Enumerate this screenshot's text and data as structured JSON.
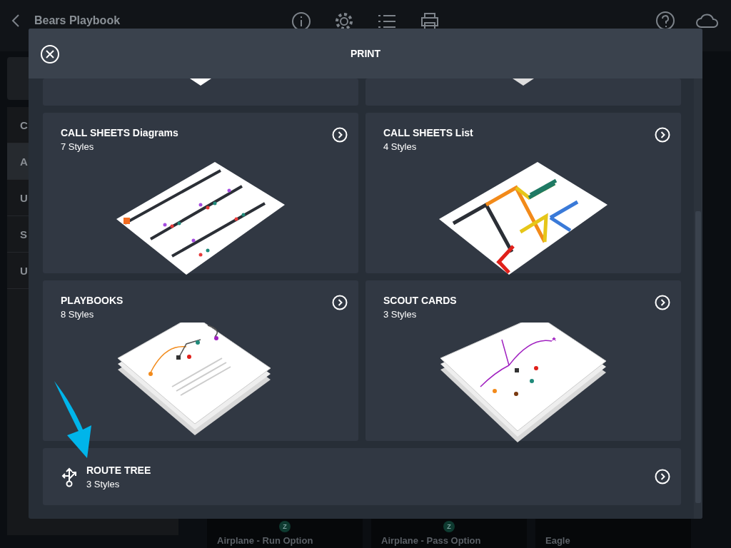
{
  "app": {
    "title": "Bears Playbook"
  },
  "sidebar": {
    "items": [
      {
        "label": "C",
        "selected": false
      },
      {
        "label": "A",
        "selected": true
      },
      {
        "label": "U",
        "selected": false
      },
      {
        "label": "S",
        "selected": false
      },
      {
        "label": "U",
        "selected": false
      }
    ]
  },
  "plays": [
    {
      "title": "Airplane - Run Option",
      "marker": "Z"
    },
    {
      "title": "Airplane - Pass Option",
      "marker": "Z"
    },
    {
      "title": "Eagle"
    }
  ],
  "dialog": {
    "title": "PRINT",
    "options": [
      {
        "kind": "diagrams",
        "title": "CALL SHEETS Diagrams",
        "styles": "7 Styles"
      },
      {
        "kind": "list",
        "title": "CALL SHEETS List",
        "styles": "4 Styles"
      },
      {
        "kind": "playbook",
        "title": "PLAYBOOKS",
        "styles": "8 Styles"
      },
      {
        "kind": "scout",
        "title": "SCOUT CARDS",
        "styles": "3 Styles"
      },
      {
        "kind": "route_tree",
        "title": "ROUTE TREE",
        "styles": "3 Styles"
      }
    ]
  }
}
